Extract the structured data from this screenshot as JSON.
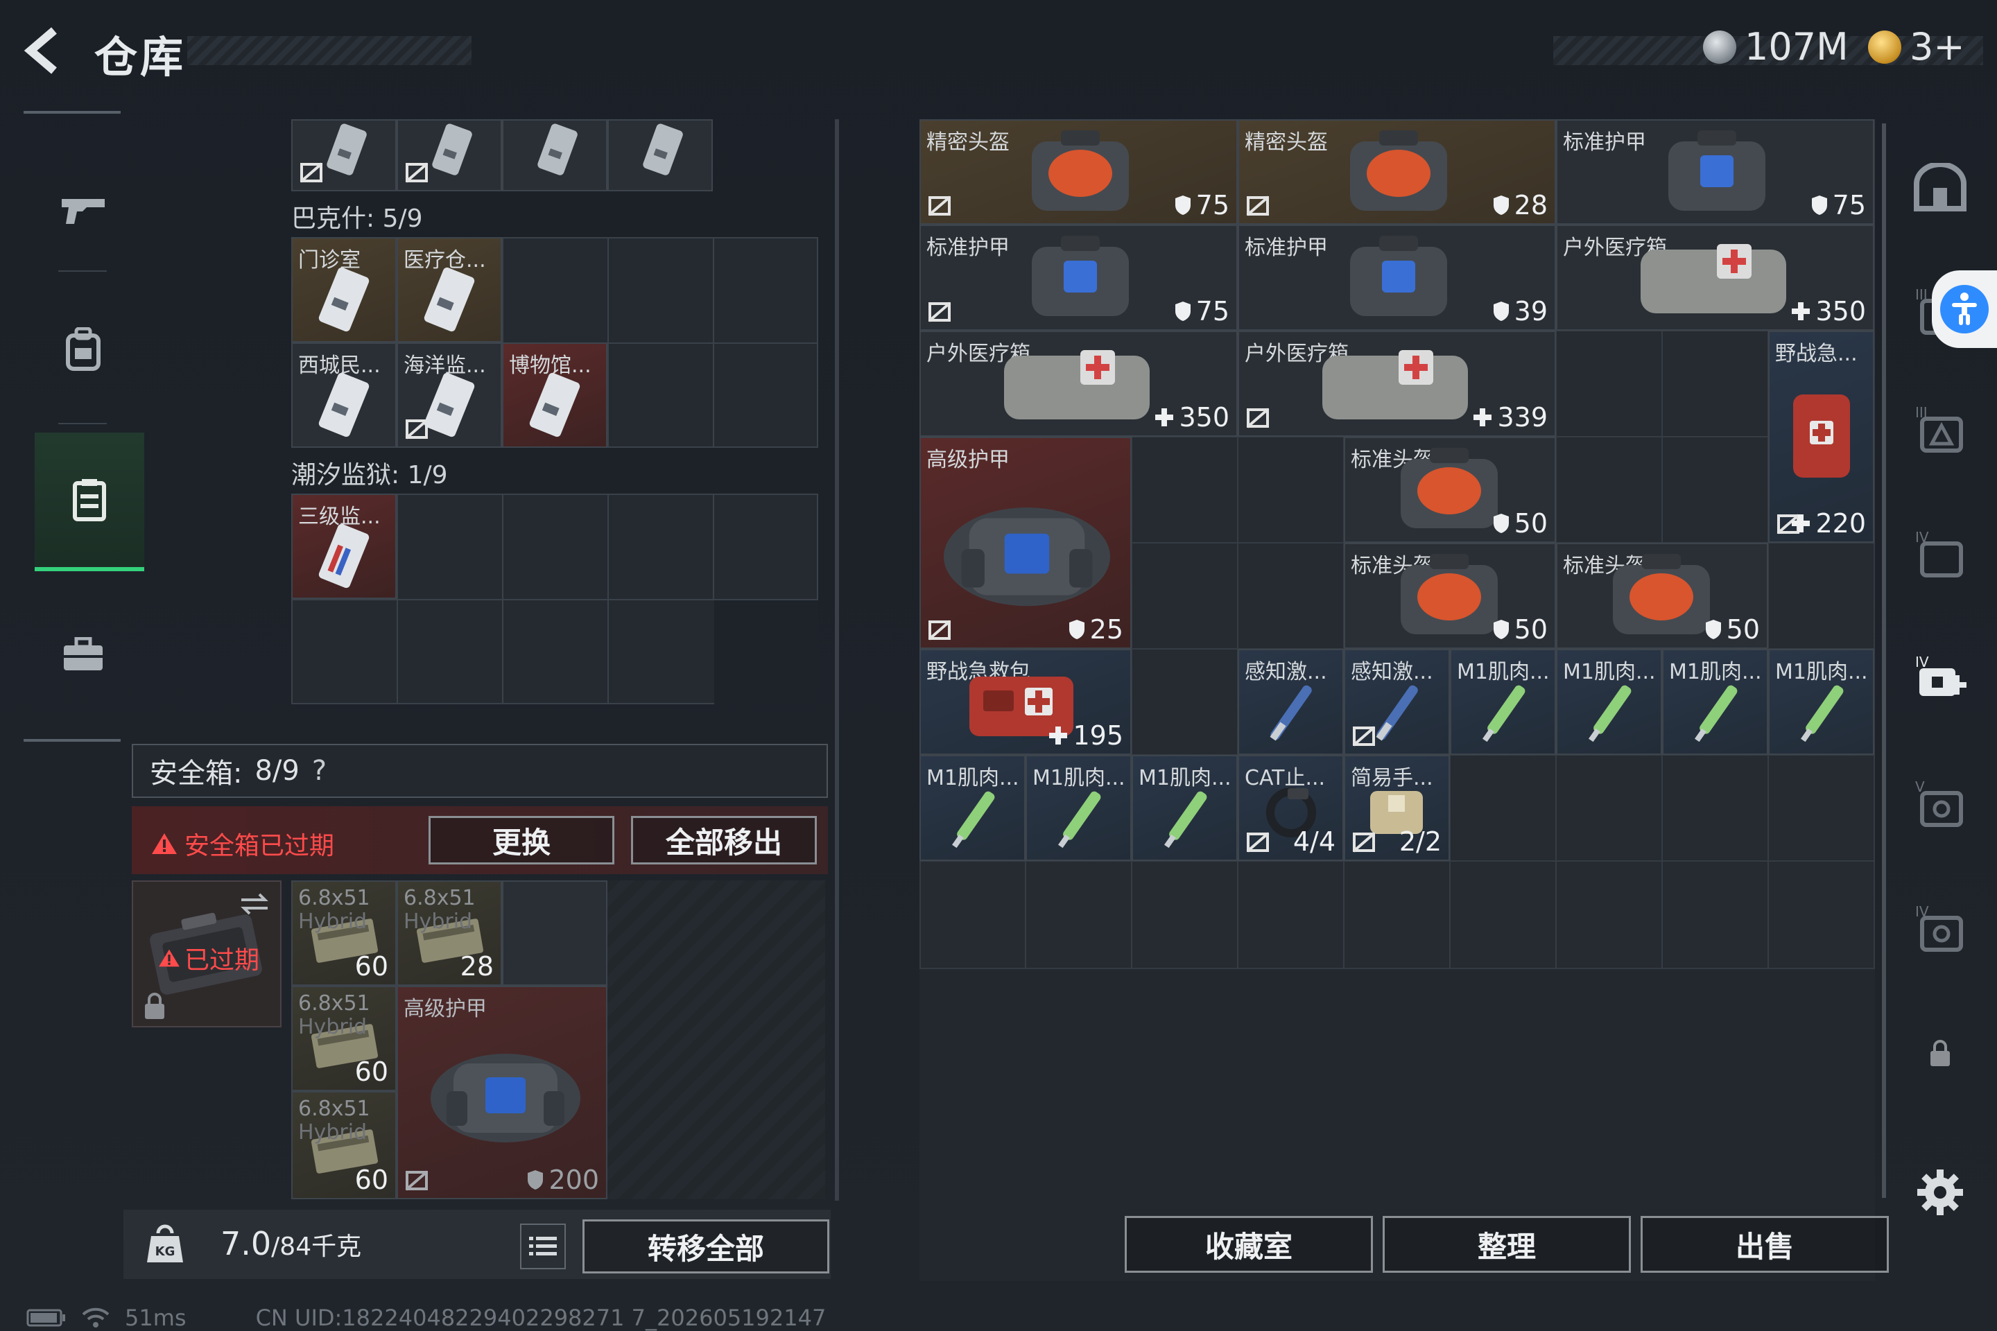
{
  "header": {
    "title": "仓库",
    "currency_silver": "107M",
    "currency_gold": "3+"
  },
  "left_nav": {
    "items": [
      "weapon",
      "backpack",
      "storage",
      "toolbox"
    ]
  },
  "storage": {
    "top_row_items": 4,
    "section_bakshi": "巴克什: 5/9",
    "bakshi_items": [
      {
        "name": "门诊室"
      },
      {
        "name": "医疗仓..."
      },
      {
        "name": "西城民..."
      },
      {
        "name": "海洋监..."
      },
      {
        "name": "博物馆..."
      }
    ],
    "section_tide": "潮汐监狱: 1/9",
    "tide_items": [
      {
        "name": "三级监..."
      }
    ]
  },
  "safebox": {
    "label": "安全箱:",
    "count": "8/9",
    "help": "?",
    "expired_warning": "安全箱已过期",
    "replace_button": "更换",
    "move_all_out_button": "全部移出",
    "expired_badge": "已过期",
    "items": [
      {
        "name": "6.8x51",
        "sub": "Hybrid",
        "qty": "60"
      },
      {
        "name": "6.8x51",
        "sub": "Hybrid",
        "qty": "28"
      },
      {
        "name": "6.8x51",
        "sub": "Hybrid",
        "qty": "60"
      },
      {
        "name": "6.8x51",
        "sub": "Hybrid",
        "qty": "60"
      },
      {
        "name": "高级护甲",
        "qty": "200"
      }
    ]
  },
  "bottom_left": {
    "weight": "7.0",
    "weight_max": "/84千克",
    "transfer_all": "转移全部"
  },
  "stash": {
    "items": [
      {
        "name": "精密头盔",
        "qty": "75"
      },
      {
        "name": "精密头盔",
        "qty": "28"
      },
      {
        "name": "标准护甲",
        "qty": "75"
      },
      {
        "name": "标准护甲",
        "qty": "75"
      },
      {
        "name": "标准护甲",
        "qty": "39"
      },
      {
        "name": "户外医疗箱",
        "qty": "350"
      },
      {
        "name": "户外医疗箱",
        "qty": "350"
      },
      {
        "name": "户外医疗箱",
        "qty": "339"
      },
      {
        "name": "野战急...",
        "qty": "220"
      },
      {
        "name": "高级护甲",
        "qty": "25"
      },
      {
        "name": "标准头盔",
        "qty": "50"
      },
      {
        "name": "标准头盔",
        "qty": "50"
      },
      {
        "name": "标准头盔",
        "qty": "50"
      },
      {
        "name": "野战急救包",
        "qty": "195"
      },
      {
        "name": "感知激..."
      },
      {
        "name": "感知激..."
      },
      {
        "name": "M1肌肉..."
      },
      {
        "name": "M1肌肉..."
      },
      {
        "name": "M1肌肉..."
      },
      {
        "name": "M1肌肉..."
      },
      {
        "name": "M1肌肉..."
      },
      {
        "name": "M1肌肉..."
      },
      {
        "name": "M1肌肉..."
      },
      {
        "name": "CAT止...",
        "qty": "4/4"
      },
      {
        "name": "简易手...",
        "qty": "2/2"
      }
    ]
  },
  "bottom_buttons": {
    "collection": "收藏室",
    "sort": "整理",
    "sell": "出售"
  },
  "status": {
    "ping": "51ms",
    "uid": "CN UID:18224048229402298271 7_202605192147"
  },
  "colors": {
    "accent_green": "#34d27b",
    "warning_red": "#ff4b4b",
    "accessibility_blue": "#2f8cff"
  }
}
